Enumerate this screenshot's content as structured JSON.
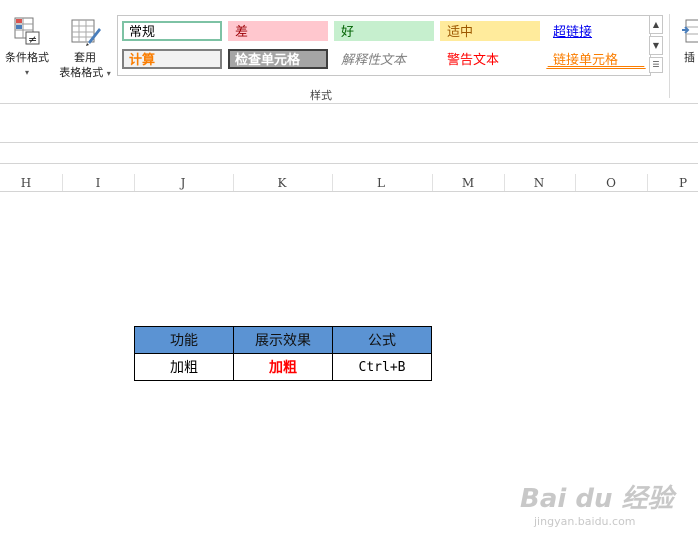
{
  "ribbon": {
    "conditional_format": {
      "label": "条件格式"
    },
    "table_format": {
      "label_line1": "套用",
      "label_line2": "表格格式"
    },
    "insert": {
      "label": "插"
    },
    "styles_group_label": "样式",
    "cell_styles": [
      {
        "name": "常规",
        "bg": "#ffffff",
        "color": "#000000",
        "border": "#7dc2a4"
      },
      {
        "name": "差",
        "bg": "#ffc7ce",
        "color": "#9c0006",
        "border": "#ffc7ce"
      },
      {
        "name": "好",
        "bg": "#c6efce",
        "color": "#006100",
        "border": "#c6efce"
      },
      {
        "name": "适中",
        "bg": "#ffeb9c",
        "color": "#9c5700",
        "border": "#ffeb9c"
      },
      {
        "name": "超链接",
        "bg": "#ffffff",
        "color": "#0000ee",
        "border": "#ffffff"
      },
      {
        "name": "计算",
        "bg": "#f2f2f2",
        "color": "#fa7d00",
        "border": "#7f7f7f"
      },
      {
        "name": "检查单元格",
        "bg": "#a5a5a5",
        "color": "#ffffff",
        "border": "#3f3f3f"
      },
      {
        "name": "解释性文本",
        "bg": "#ffffff",
        "color": "#7f7f7f",
        "border": "#ffffff"
      },
      {
        "name": "警告文本",
        "bg": "#ffffff",
        "color": "#ff0000",
        "border": "#ffffff"
      },
      {
        "name": "链接单元格",
        "bg": "#ffffff",
        "color": "#fa7d00",
        "border": "#ffffff"
      }
    ]
  },
  "columns": [
    "H",
    "I",
    "J",
    "K",
    "L",
    "M",
    "N",
    "O",
    "P"
  ],
  "table": {
    "header": [
      "功能",
      "展示效果",
      "公式"
    ],
    "row": [
      "加粗",
      "加粗",
      "Ctrl+B"
    ],
    "header_bg": "#5b93d3",
    "effect_color": "#ff0000"
  },
  "watermark": {
    "brand": "Bai du 经验",
    "url": "jingyan.baidu.com"
  }
}
